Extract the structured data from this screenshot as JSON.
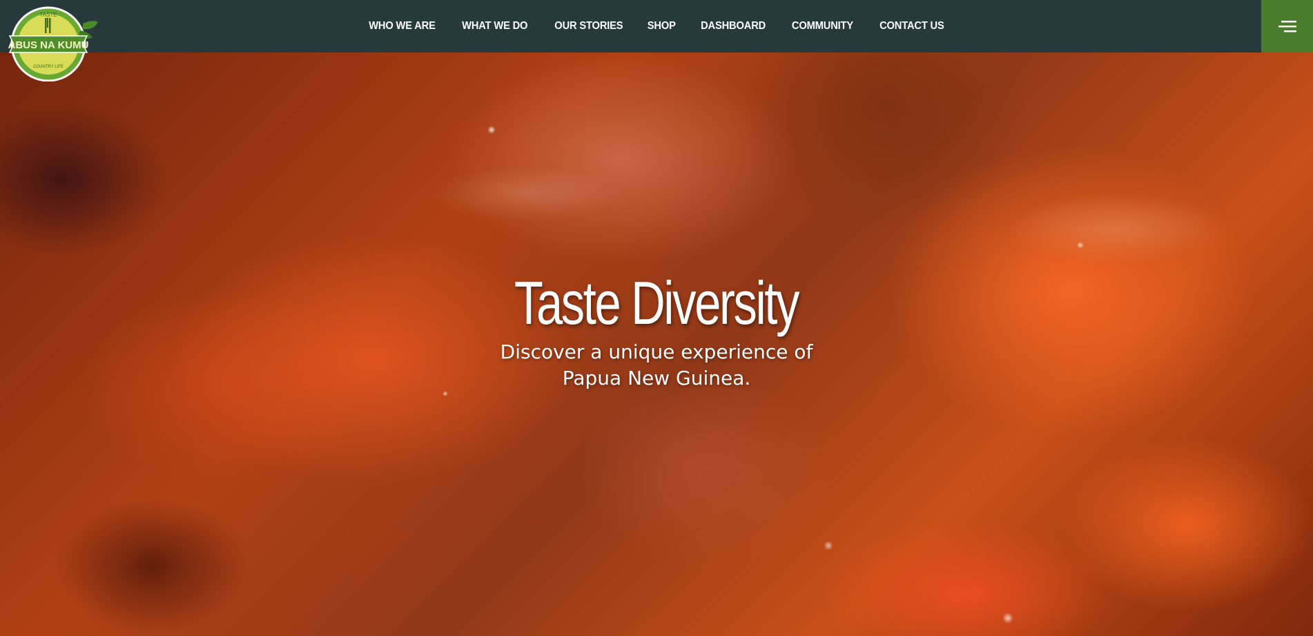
{
  "header": {
    "nav": [
      {
        "label": "WHO WE ARE"
      },
      {
        "label": "WHAT WE DO"
      },
      {
        "label": "OUR STORIES"
      },
      {
        "label": "SHOP"
      },
      {
        "label": "DASHBOARD"
      },
      {
        "label": "COMMUNITY"
      },
      {
        "label": "CONTACT US"
      }
    ],
    "menu_icon": "hamburger-menu-icon",
    "colors": {
      "bar": "#263a3c",
      "menu_button": "#4a7d2b"
    }
  },
  "logo": {
    "name": "ABUS NA KUMU",
    "arc_text": "TASTE",
    "tagline": "COUNTRY LIFE"
  },
  "hero": {
    "title": "Taste Diversity",
    "subtitle": "Discover a unique experience of Papua New Guinea."
  }
}
